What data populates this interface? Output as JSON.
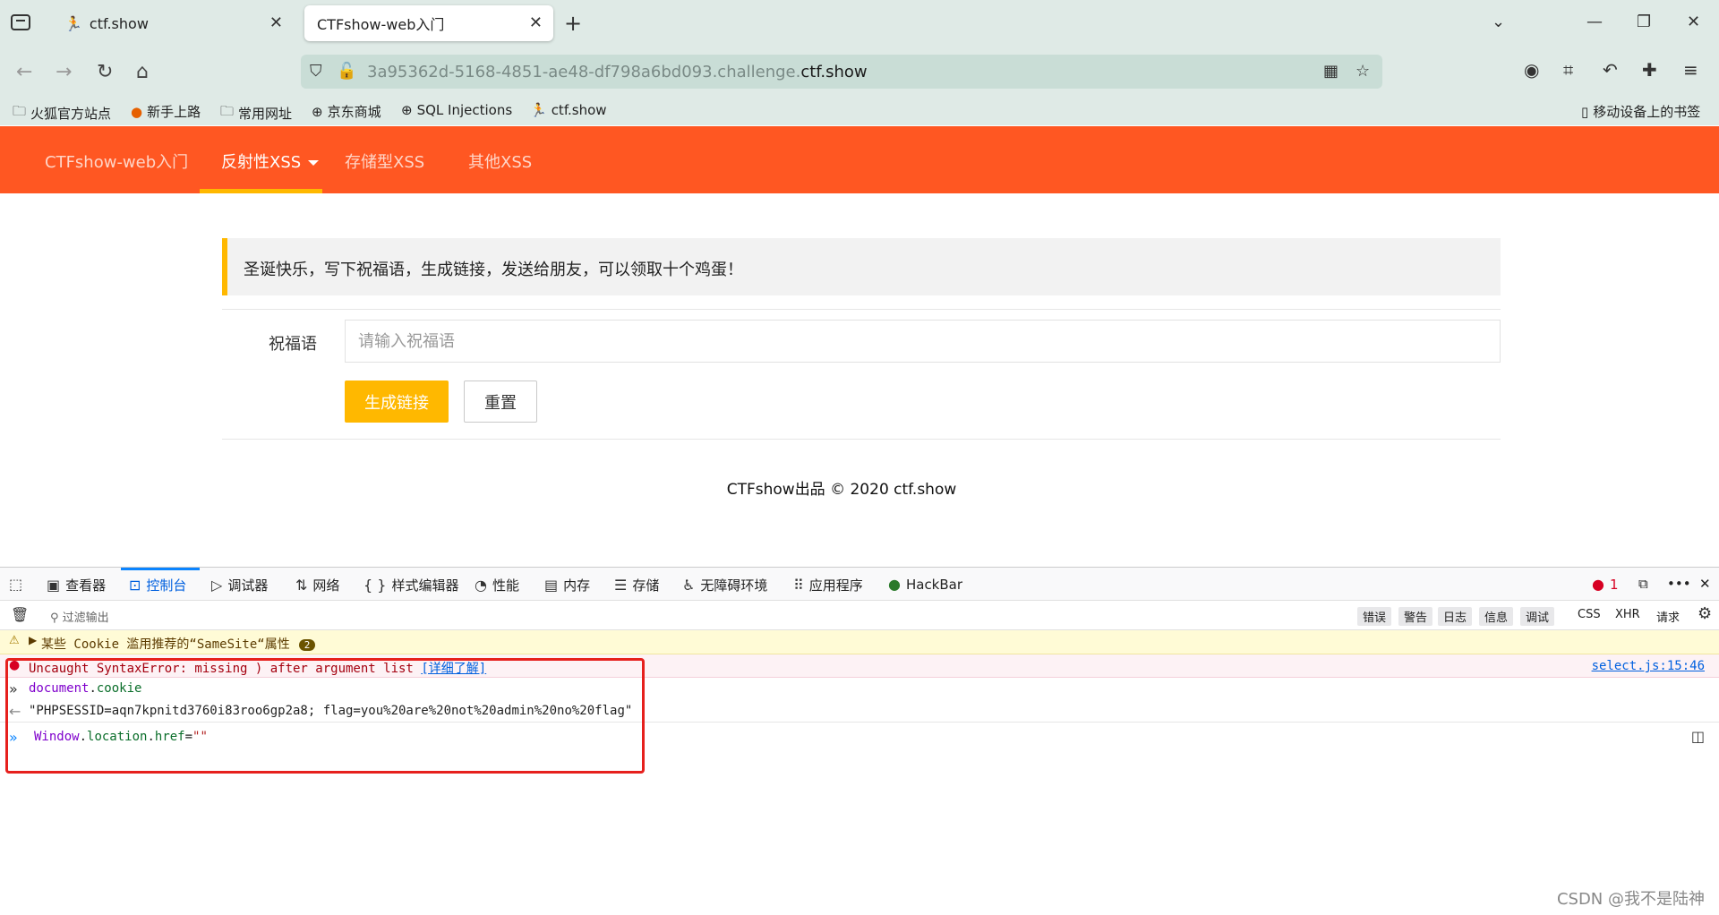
{
  "browser": {
    "tabs": [
      {
        "title": "ctf.show",
        "active": false
      },
      {
        "title": "CTFshow-web入门",
        "active": true
      }
    ],
    "url_prefix": "3a95362d-5168-4851-ae48-df798a6bd093.challenge.",
    "url_domain": "ctf.show",
    "bookmarks": [
      "火狐官方站点",
      "新手上路",
      "常用网址",
      "京东商城",
      "SQL Injections",
      "ctf.show"
    ],
    "mobile_bookmarks": "移动设备上的书签"
  },
  "site": {
    "nav": [
      {
        "label": "CTFshow-web入门"
      },
      {
        "label": "反射性XSS"
      },
      {
        "label": "存储型XSS"
      },
      {
        "label": "其他XSS"
      }
    ],
    "notice": "圣诞快乐，写下祝福语，生成链接，发送给朋友，可以领取十个鸡蛋！",
    "form_label": "祝福语",
    "input_placeholder": "请输入祝福语",
    "submit_label": "生成链接",
    "reset_label": "重置",
    "footer": "CTFshow出品 © 2020 ctf.show"
  },
  "devtools": {
    "tabs": [
      "查看器",
      "控制台",
      "调试器",
      "网络",
      "样式编辑器",
      "性能",
      "内存",
      "存储",
      "无障碍环境",
      "应用程序",
      "HackBar"
    ],
    "active_tab": "控制台",
    "error_count": "1",
    "filter_placeholder": "过滤输出",
    "filters": [
      "错误",
      "警告",
      "日志",
      "信息",
      "调试"
    ],
    "filters_plain": [
      "CSS",
      "XHR",
      "请求"
    ],
    "warning": {
      "text": "某些 Cookie 滥用推荐的“SameSite“属性",
      "count": "2"
    },
    "error": {
      "text": "Uncaught SyntaxError: missing ) after argument list",
      "link": "[详细了解]",
      "source": "select.js:15:46"
    },
    "input1": {
      "obj": "document",
      "dot": ".",
      "prop": "cookie"
    },
    "output1": "\"PHPSESSID=aqn7kpnitd3760i83roo6gp2a8; flag=you%20are%20not%20admin%20no%20flag\"",
    "input2": {
      "obj": "Window",
      "dot1": ".",
      "p1": "location",
      "dot2": ".",
      "p2": "href",
      "eq": "=",
      "str": "\"\""
    }
  },
  "watermark": "CSDN @我不是陆神"
}
